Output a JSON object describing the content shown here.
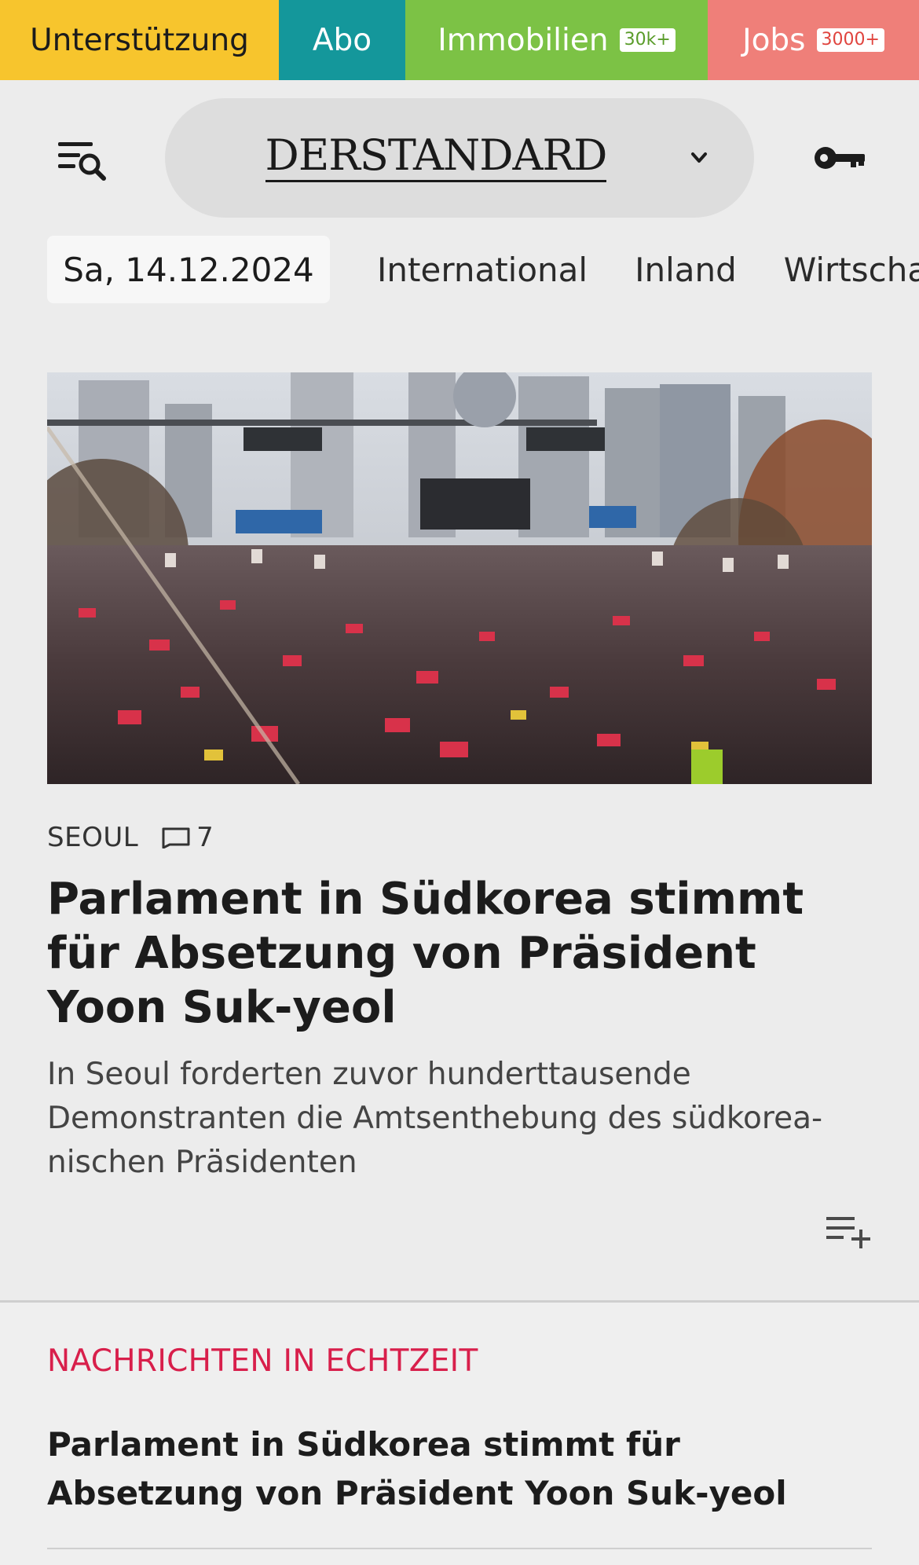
{
  "topbar": {
    "support_label": "Unterstützung",
    "abo_label": "Abo",
    "realestate_label": "Immobilien",
    "realestate_badge": "30k+",
    "jobs_label": "Jobs",
    "jobs_badge": "3000+"
  },
  "header": {
    "logo_text": "DERSTANDARD",
    "icons": [
      "menu-search-icon",
      "chevron-down-icon",
      "key-icon"
    ]
  },
  "navigation": {
    "date": "Sa, 14.12.2024",
    "items": [
      "International",
      "Inland",
      "Wirtscha"
    ]
  },
  "article": {
    "kicker": "SEOUL",
    "comment_count": "7",
    "headline": "Parlament in Südkorea stimmt für Absetzung von Präsident Yoon Suk-yeol",
    "teaser": "In Seoul forderten zuvor hunderttausende Demonstranten die Amtsenthebung des südkorea­nischen Präsidenten"
  },
  "live": {
    "label": "NACHRICHTEN IN ECHTZEIT",
    "headline": "Parlament in Südkorea stimmt für Absetzung von Präsident Yoon Suk-yeol"
  },
  "colors": {
    "support": "#f7c52d",
    "abo": "#14979b",
    "realestate": "#7cc245",
    "jobs": "#ef7f79",
    "live_accent": "#d81f4b",
    "background": "#ececec"
  }
}
